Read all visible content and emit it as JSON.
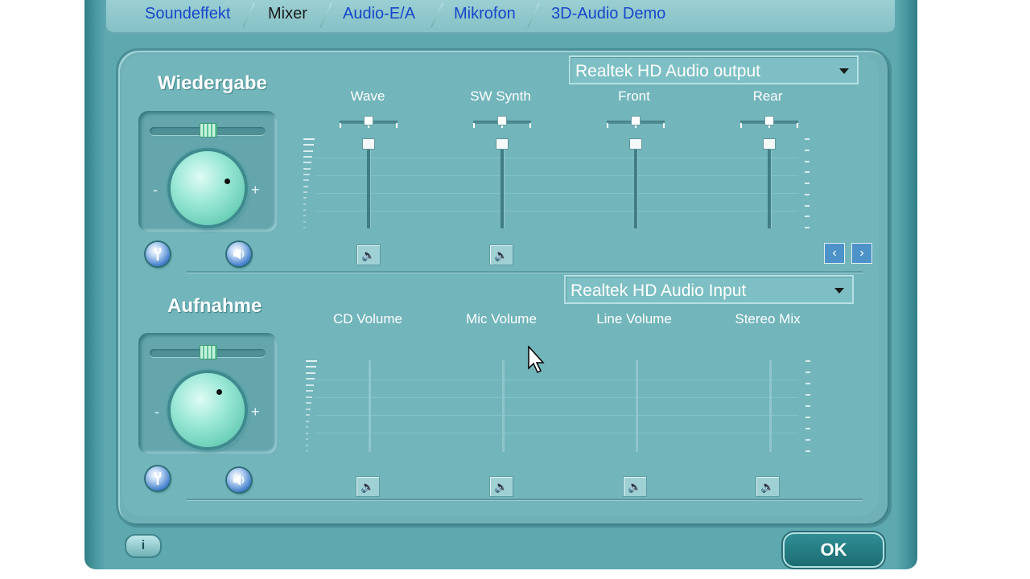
{
  "tabs": [
    {
      "label": "Soundeffekt",
      "active": false
    },
    {
      "label": "Mixer",
      "active": true
    },
    {
      "label": "Audio-E/A",
      "active": false
    },
    {
      "label": "Mikrofon",
      "active": false
    },
    {
      "label": "3D-Audio Demo",
      "active": false
    }
  ],
  "playback": {
    "title": "Wiedergabe",
    "device": "Realtek HD Audio output",
    "knob_minus": "-",
    "knob_plus": "+",
    "channels": [
      {
        "label": "Wave",
        "level": 1.0
      },
      {
        "label": "SW Synth",
        "level": 1.0
      },
      {
        "label": "Front",
        "level": 1.0
      },
      {
        "label": "Rear",
        "level": 1.0
      }
    ]
  },
  "recording": {
    "title": "Aufnahme",
    "device": "Realtek HD Audio Input",
    "knob_minus": "-",
    "knob_plus": "+",
    "channels": [
      {
        "label": "CD Volume"
      },
      {
        "label": "Mic Volume"
      },
      {
        "label": "Line Volume"
      },
      {
        "label": "Stereo Mix"
      }
    ]
  },
  "footer": {
    "ok_label": "OK",
    "info_label": "i"
  },
  "icons": {
    "settings": "wrench-icon",
    "speaker": "speaker-icon",
    "mute": "speaker-mute-icon",
    "prev": "chevron-left-icon",
    "next": "chevron-right-icon"
  },
  "colors": {
    "tab_link": "#1747c8",
    "panel": "#72b5bb",
    "window": "#5ea8b0"
  }
}
